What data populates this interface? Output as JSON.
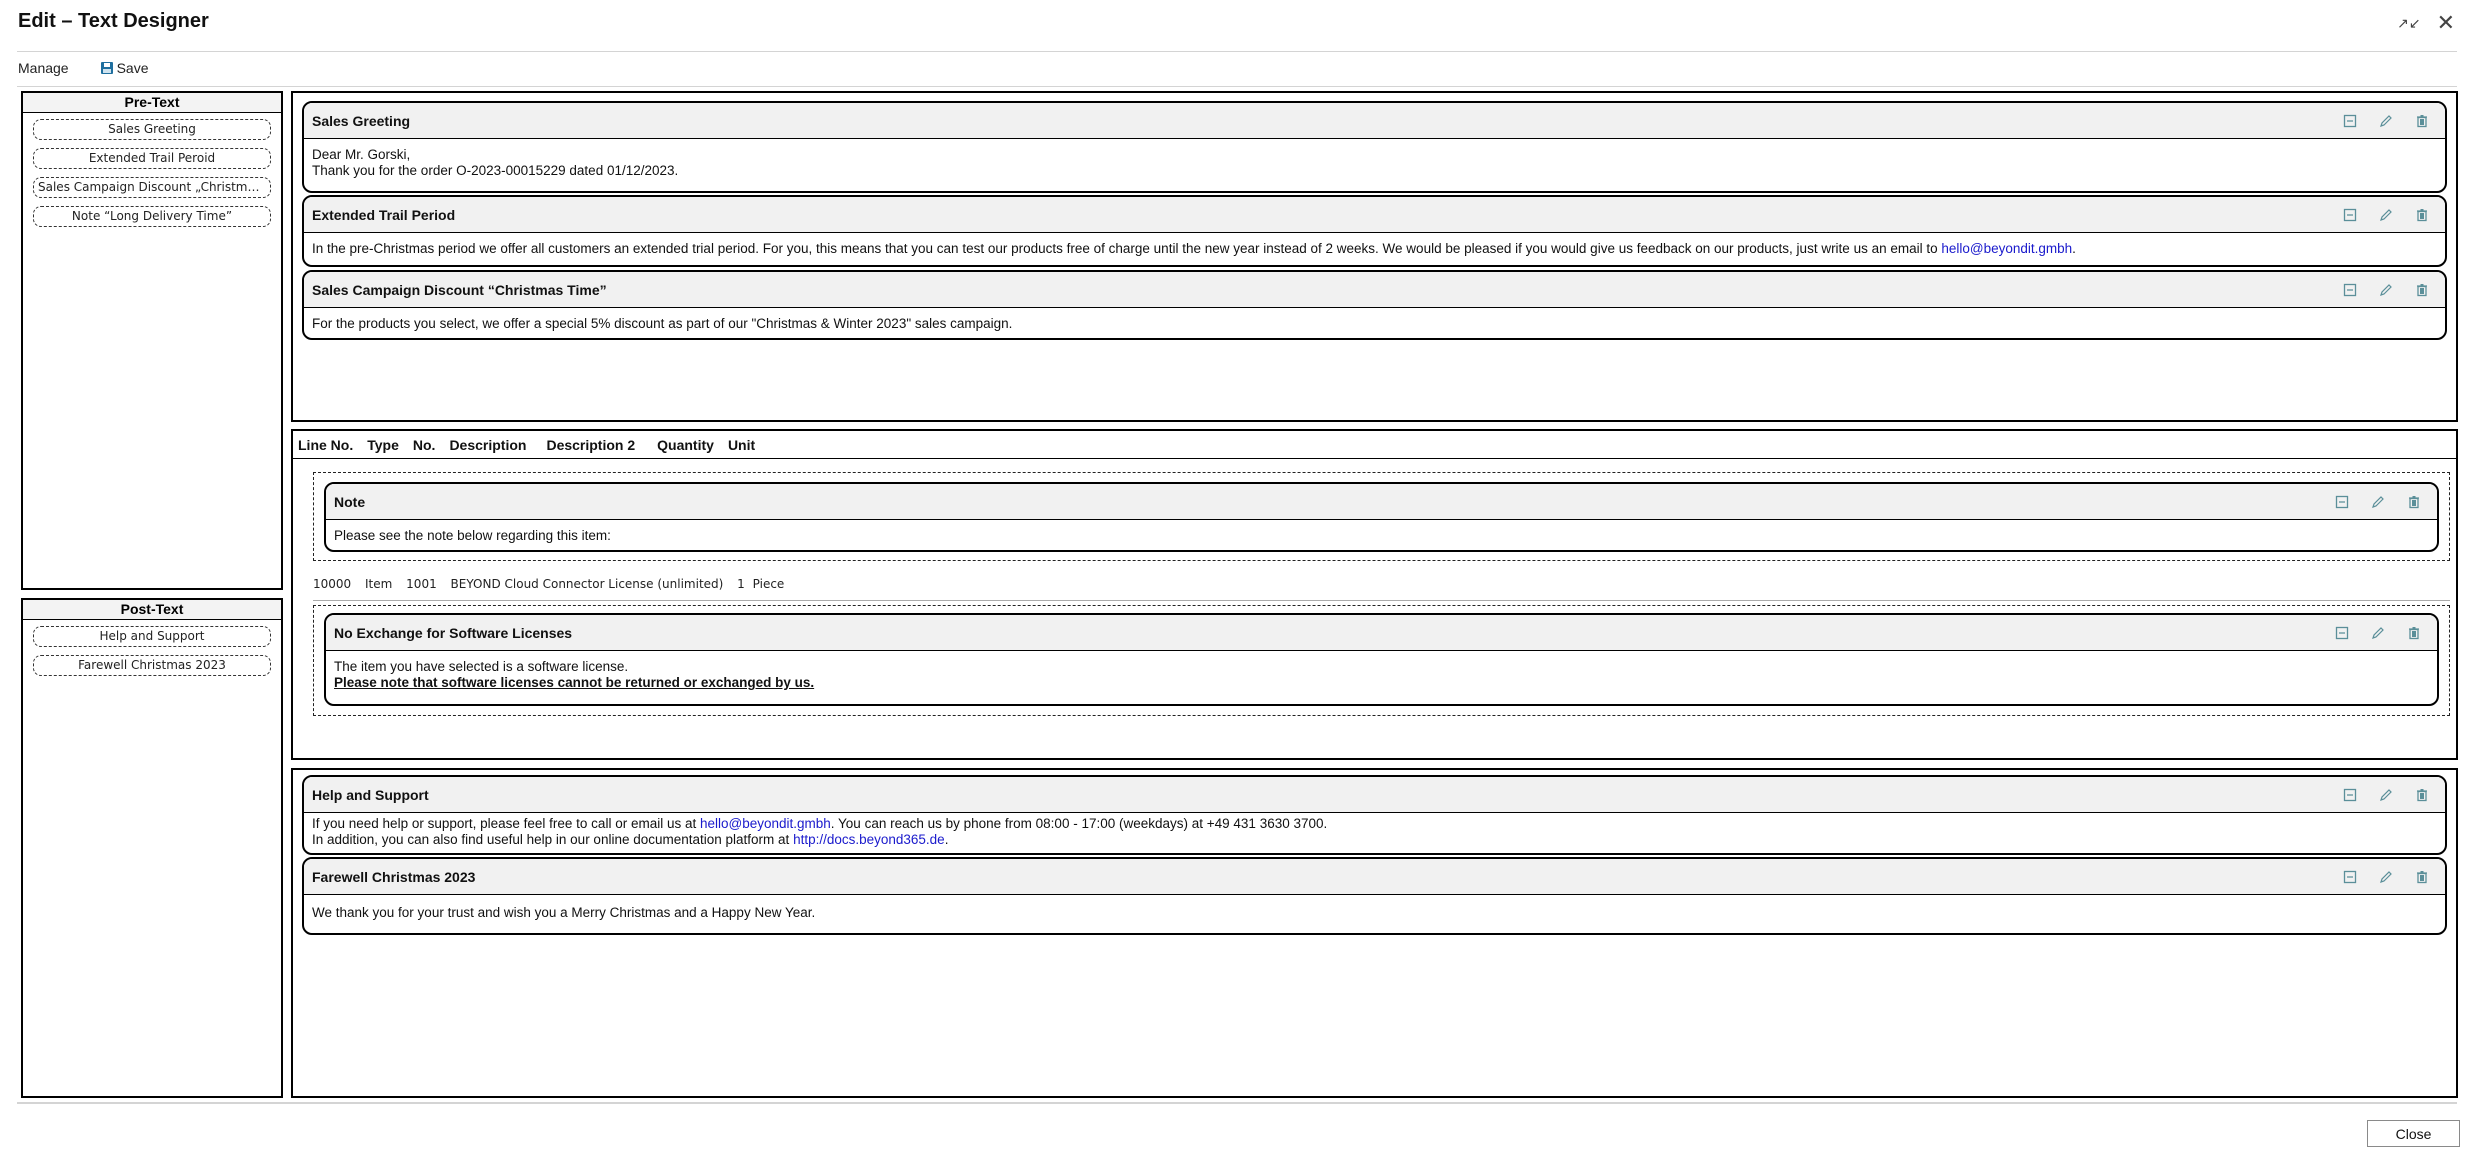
{
  "window": {
    "title": "Edit – Text Designer",
    "icons": [
      "collapse-icon",
      "close-icon"
    ]
  },
  "toolbar": {
    "manage_label": "Manage",
    "save_label": "Save",
    "save_icon": "floppy-disk-icon"
  },
  "pre_text_panel": {
    "heading": "Pre-Text",
    "items": [
      {
        "label": "Sales Greeting"
      },
      {
        "label": "Extended Trail Peroid"
      },
      {
        "label": "Sales Campaign Discount „Christmas ..."
      },
      {
        "label": "Note “Long Delivery Time”"
      }
    ]
  },
  "post_text_panel": {
    "heading": "Post-Text",
    "items": [
      {
        "label": "Help and Support"
      },
      {
        "label": "Farewell Christmas 2023"
      }
    ]
  },
  "card_actions": {
    "collapse": "collapse-icon",
    "edit": "pencil-icon",
    "delete": "trash-icon",
    "icon_color": "#5b8f99"
  },
  "pre_text_blocks": [
    {
      "title": "Sales Greeting",
      "line1": "Dear Mr. Gorski,",
      "line2": "Thank you for the order O-2023-00015229 dated 01/12/2023."
    },
    {
      "title": "Extended Trail Period",
      "text": "In the pre-Christmas period we offer all customers an extended trial period. For you, this means that you can test our products free of charge until the new year instead of 2 weeks. We would be pleased if you would give us feedback on our products, just write us an email to ",
      "link": "hello@beyondit.gmbh",
      "after": "."
    },
    {
      "title": "Sales Campaign Discount “Christmas Time”",
      "text": "For the products you select, we offer a special 5% discount as part of our \"Christmas & Winter 2023\" sales campaign."
    }
  ],
  "lines": {
    "columns": [
      "Line No.",
      "Type",
      "No.",
      "Description",
      "Description 2",
      "Quantity",
      "Unit"
    ],
    "note_block": {
      "title": "Note",
      "text": "Please see the note below regarding this item:"
    },
    "item": {
      "line_no": "10000",
      "type": "Item",
      "no": "1001",
      "description": "BEYOND Cloud Connector License (unlimited)",
      "quantity": "1",
      "unit": "Piece"
    },
    "attached_block": {
      "title": "No Exchange for Software Licenses",
      "line1": "The item you have selected is a software license.",
      "line2": "Please note that software licenses cannot be returned or exchanged by us."
    }
  },
  "post_text_blocks": [
    {
      "title": "Help and Support",
      "l1_pre": "If you need help or support, please feel free to call or email us at ",
      "l1_link": "hello@beyondit.gmbh",
      "l1_post": ". You can reach us by phone from 08:00 - 17:00 (weekdays) at  +49 431 3630 3700.",
      "l2_pre": "In addition, you can also find useful help in our online documentation platform at ",
      "l2_link": "http://docs.beyond365.de",
      "l2_post": "."
    },
    {
      "title": "Farewell Christmas 2023",
      "text": "We thank you for your trust and wish you a Merry Christmas and a Happy New Year."
    }
  ],
  "footer": {
    "close_label": "Close"
  }
}
